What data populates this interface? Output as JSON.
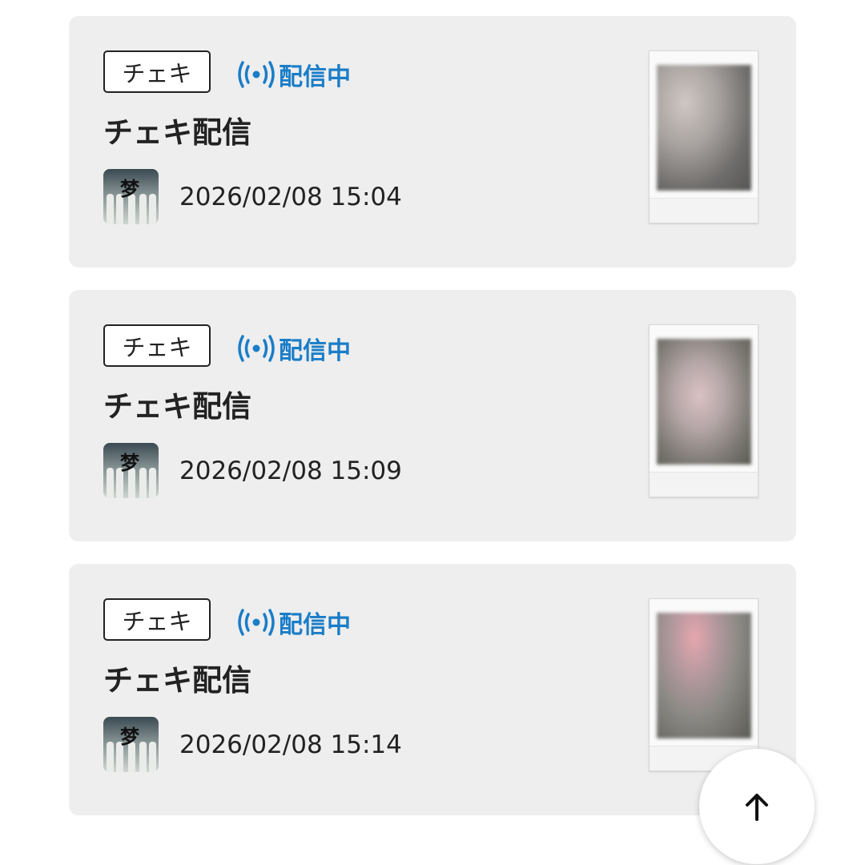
{
  "items": [
    {
      "tag": "チェキ",
      "status": "配信中",
      "title": "チェキ配信",
      "datetime": "2026/02/08 15:04"
    },
    {
      "tag": "チェキ",
      "status": "配信中",
      "title": "チェキ配信",
      "datetime": "2026/02/08 15:09"
    },
    {
      "tag": "チェキ",
      "status": "配信中",
      "title": "チェキ配信",
      "datetime": "2026/02/08 15:14"
    }
  ],
  "icons": {
    "live": "broadcast-icon",
    "scroll_top": "arrow-up-icon"
  },
  "colors": {
    "accent": "#1a7dc8",
    "card_bg": "#eeeeee"
  }
}
